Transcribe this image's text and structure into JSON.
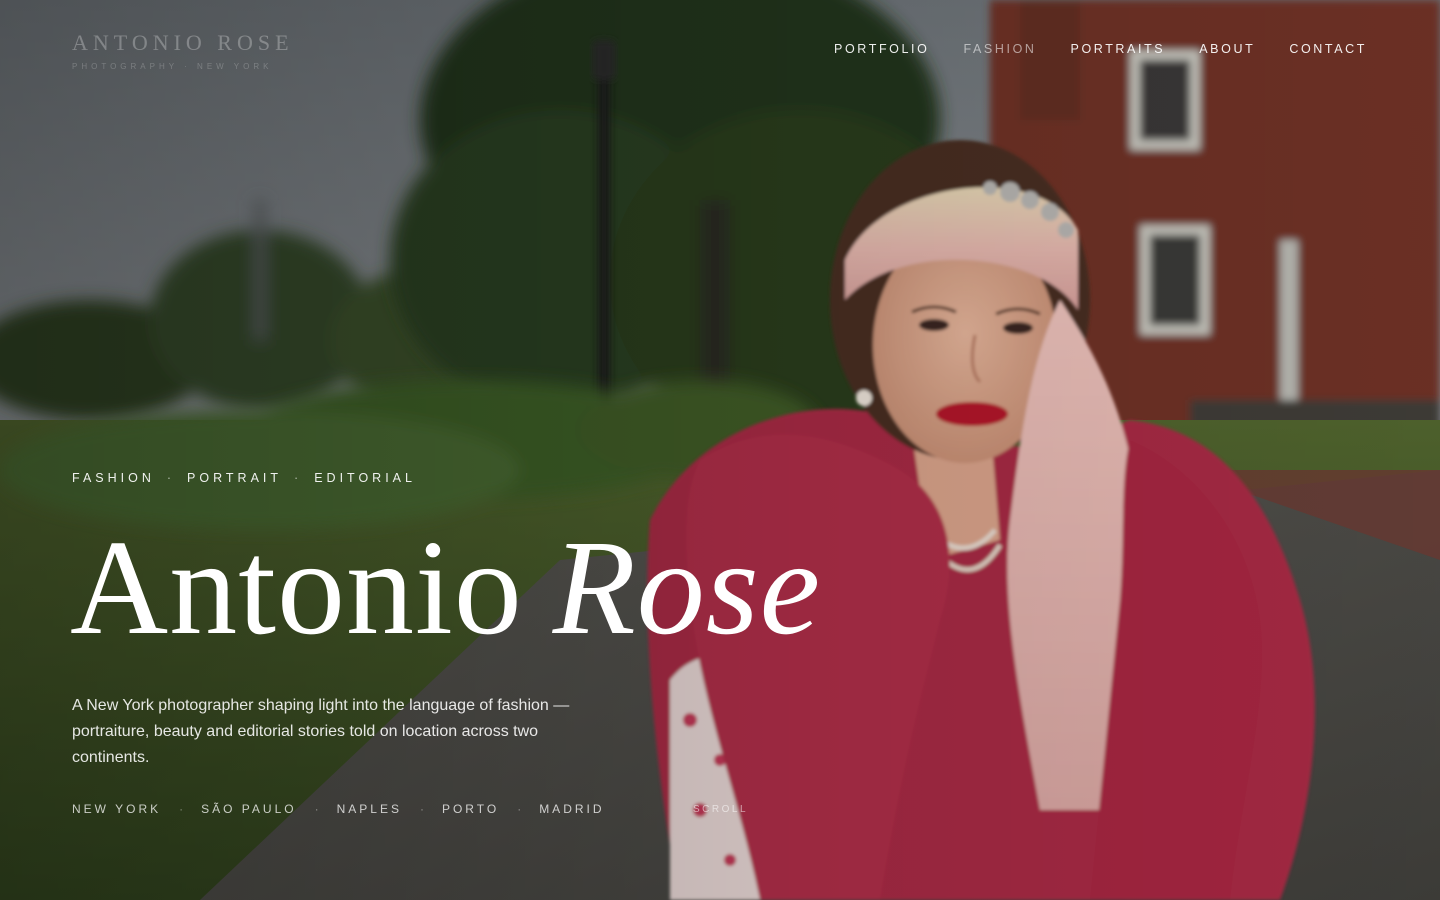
{
  "header": {
    "logo": "ANTONIO ROSE",
    "tagline": "PHOTOGRAPHY · NEW YORK",
    "nav": [
      {
        "label": "PORTFOLIO"
      },
      {
        "label": "FASHION"
      },
      {
        "label": "PORTRAITS"
      },
      {
        "label": "ABOUT"
      },
      {
        "label": "CONTACT"
      }
    ]
  },
  "hero": {
    "eyebrow": [
      "FASHION",
      "PORTRAIT",
      "EDITORIAL"
    ],
    "eyebrow_separator": "·",
    "title_first": "Antonio",
    "title_last": "Rose",
    "lede": "A New York photographer shaping light into the language of fashion — portraiture, beauty and editorial stories told on location across two continents.",
    "cities": [
      "NEW YORK",
      "SÃO PAULO",
      "NAPLES",
      "PORTO",
      "MADRID"
    ],
    "city_separator": "·",
    "scroll": "SCROLL"
  },
  "colors": {
    "text": "#ffffff",
    "boa": "#b8304a",
    "scarf": "#e9b7b3",
    "brick": "#7a3a2c",
    "foliage": "#3e5a2a"
  }
}
